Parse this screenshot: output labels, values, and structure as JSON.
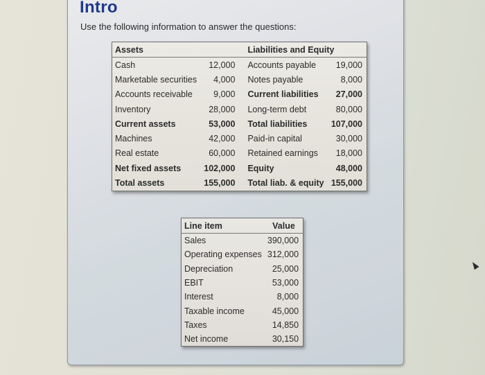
{
  "header": {
    "title": "Intro",
    "instruction": "Use the following information to answer the questions:"
  },
  "balance_sheet": {
    "assets_header": "Assets",
    "liabilities_header": "Liabilities and Equity",
    "rows": [
      {
        "asset": "Cash",
        "asset_value": "12,000",
        "asset_bold": false,
        "liability": "Accounts payable",
        "liability_value": "19,000",
        "liability_bold": false
      },
      {
        "asset": "Marketable securities",
        "asset_value": "4,000",
        "asset_bold": false,
        "liability": "Notes payable",
        "liability_value": "8,000",
        "liability_bold": false
      },
      {
        "asset": "Accounts receivable",
        "asset_value": "9,000",
        "asset_bold": false,
        "liability": "Current liabilities",
        "liability_value": "27,000",
        "liability_bold": true
      },
      {
        "asset": "Inventory",
        "asset_value": "28,000",
        "asset_bold": false,
        "liability": "Long-term debt",
        "liability_value": "80,000",
        "liability_bold": false
      },
      {
        "asset": "Current assets",
        "asset_value": "53,000",
        "asset_bold": true,
        "liability": "Total liabilities",
        "liability_value": "107,000",
        "liability_bold": true
      },
      {
        "asset": "Machines",
        "asset_value": "42,000",
        "asset_bold": false,
        "liability": "Paid-in capital",
        "liability_value": "30,000",
        "liability_bold": false
      },
      {
        "asset": "Real estate",
        "asset_value": "60,000",
        "asset_bold": false,
        "liability": "Retained earnings",
        "liability_value": "18,000",
        "liability_bold": false
      },
      {
        "asset": "Net fixed assets",
        "asset_value": "102,000",
        "asset_bold": true,
        "liability": "Equity",
        "liability_value": "48,000",
        "liability_bold": true
      },
      {
        "asset": "Total assets",
        "asset_value": "155,000",
        "asset_bold": true,
        "liability": "Total liab. & equity",
        "liability_value": "155,000",
        "liability_bold": true
      }
    ]
  },
  "income_statement": {
    "headers": {
      "line_item": "Line item",
      "value": "Value"
    },
    "rows": [
      {
        "item": "Sales",
        "value": "390,000"
      },
      {
        "item": "Operating expenses",
        "value": "312,000"
      },
      {
        "item": "Depreciation",
        "value": "25,000"
      },
      {
        "item": "EBIT",
        "value": "53,000"
      },
      {
        "item": "Interest",
        "value": "8,000"
      },
      {
        "item": "Taxable income",
        "value": "45,000"
      },
      {
        "item": "Taxes",
        "value": "14,850"
      },
      {
        "item": "Net income",
        "value": "30,150"
      }
    ]
  },
  "colors": {
    "title": "#1f3a8a"
  }
}
